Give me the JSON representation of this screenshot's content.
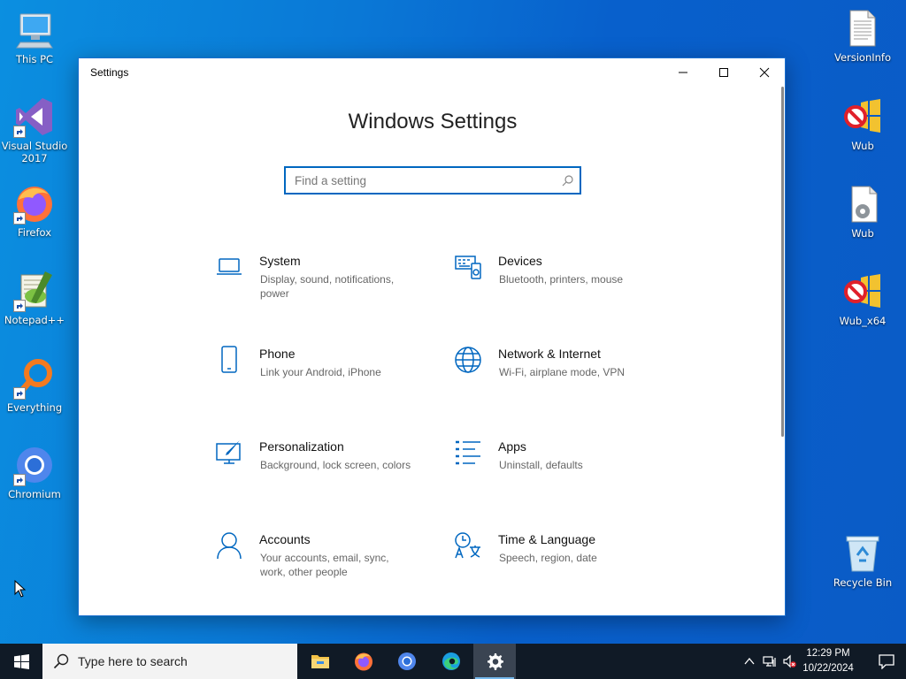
{
  "desktop": {
    "left_icons": [
      {
        "label": "This PC",
        "icon": "computer-icon"
      },
      {
        "label": "Visual Studio 2017",
        "icon": "visual-studio-icon"
      },
      {
        "label": "Firefox",
        "icon": "firefox-icon"
      },
      {
        "label": "Notepad++",
        "icon": "notepad-plus-plus-icon"
      },
      {
        "label": "Everything",
        "icon": "everything-search-icon"
      },
      {
        "label": "Chromium",
        "icon": "chromium-icon"
      }
    ],
    "right_icons": [
      {
        "label": "VersionInfo",
        "icon": "text-file-icon"
      },
      {
        "label": "Wub",
        "icon": "windows-update-blocker-icon"
      },
      {
        "label": "Wub",
        "icon": "settings-file-icon"
      },
      {
        "label": "Wub_x64",
        "icon": "windows-update-blocker-icon"
      },
      {
        "label": "Recycle Bin",
        "icon": "recycle-bin-icon"
      }
    ]
  },
  "settings_window": {
    "title": "Settings",
    "heading": "Windows Settings",
    "search_placeholder": "Find a setting",
    "accent_color": "#0067c0",
    "categories": [
      {
        "name": "System",
        "description": "Display, sound, notifications, power",
        "icon": "laptop-icon"
      },
      {
        "name": "Devices",
        "description": "Bluetooth, printers, mouse",
        "icon": "keyboard-devices-icon"
      },
      {
        "name": "Phone",
        "description": "Link your Android, iPhone",
        "icon": "phone-icon"
      },
      {
        "name": "Network & Internet",
        "description": "Wi-Fi, airplane mode, VPN",
        "icon": "globe-icon"
      },
      {
        "name": "Personalization",
        "description": "Background, lock screen, colors",
        "icon": "paint-brush-icon"
      },
      {
        "name": "Apps",
        "description": "Uninstall, defaults",
        "icon": "apps-list-icon"
      },
      {
        "name": "Accounts",
        "description": "Your accounts, email, sync, work, other people",
        "icon": "person-icon"
      },
      {
        "name": "Time & Language",
        "description": "Speech, region, date",
        "icon": "time-language-icon"
      }
    ]
  },
  "taskbar": {
    "search_placeholder": "Type here to search",
    "apps": [
      "file-explorer-icon",
      "firefox-icon",
      "chromium-icon",
      "edge-icon",
      "settings-gear-icon"
    ],
    "active_app": "settings-gear-icon",
    "time": "12:29 PM",
    "date": "10/22/2024"
  }
}
